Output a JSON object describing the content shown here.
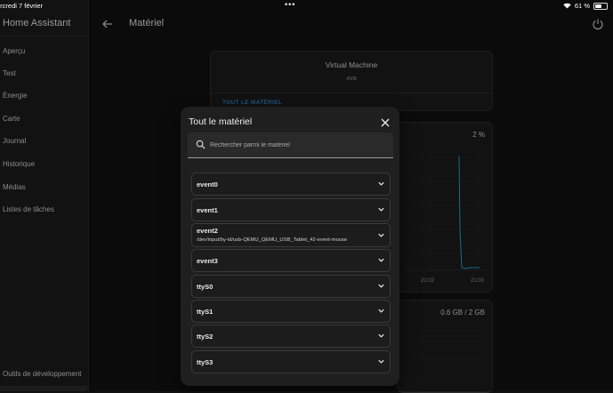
{
  "status_bar": {
    "date": "ercredi 7 février",
    "dots": "•••",
    "battery": "61 %",
    "battery_level": 0.61
  },
  "sidebar": {
    "title": "Home Assistant",
    "items": [
      {
        "label": "Aperçu"
      },
      {
        "label": "Test"
      },
      {
        "label": "Énergie"
      },
      {
        "label": "Carte"
      },
      {
        "label": "Journal"
      },
      {
        "label": "Historique"
      },
      {
        "label": "Médias"
      },
      {
        "label": "Listes de tâches"
      }
    ],
    "dev_tools": "Outils de développement"
  },
  "header": {
    "title": "Matériel"
  },
  "background": {
    "vm_title": "Virtual Machine",
    "vm_subtitle": "ova",
    "vm_link": "TOUT LE MATÉRIEL",
    "cpu_percent": "2 %",
    "cpu_tick_1": "21:02",
    "cpu_tick_2": "21:03",
    "memory": "0.6 GB / 2 GB"
  },
  "dialog": {
    "title": "Tout le matériel",
    "search_placeholder": "Rechercher parmi le matériel",
    "devices": [
      {
        "name": "event0",
        "path": ""
      },
      {
        "name": "event1",
        "path": ""
      },
      {
        "name": "event2",
        "path": "/dev/input/by-id/usb-QEMU_QEMU_USB_Tablet_42-event-mouse"
      },
      {
        "name": "event3",
        "path": ""
      },
      {
        "name": "ttyS0",
        "path": ""
      },
      {
        "name": "ttyS1",
        "path": ""
      },
      {
        "name": "ttyS2",
        "path": ""
      },
      {
        "name": "ttyS3",
        "path": ""
      }
    ]
  }
}
